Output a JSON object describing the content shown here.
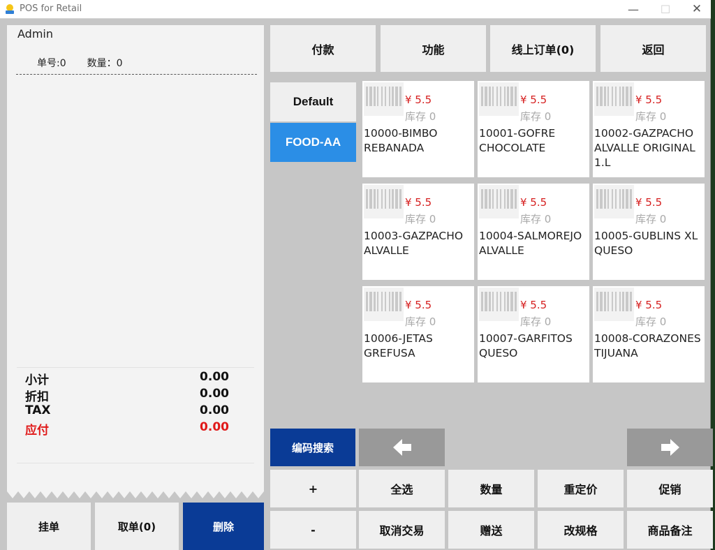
{
  "window": {
    "title": "POS for Retail",
    "minimize": "—",
    "maximize": "☐",
    "close": "✕"
  },
  "receipt": {
    "user": "Admin",
    "order_no": "单号:0",
    "quantity": "数量：0",
    "summary": [
      {
        "label": "小计",
        "value": "0.00"
      },
      {
        "label": "折扣",
        "value": "0.00"
      },
      {
        "label": "TAX",
        "value": "0.00"
      },
      {
        "label": "应付",
        "value": "0.00"
      }
    ]
  },
  "bottom_actions": {
    "hold": "挂单",
    "retrieve": "取单(0)",
    "delete": "删除"
  },
  "top_actions": {
    "pay": "付款",
    "functions": "功能",
    "online_orders": "线上订单(0)",
    "back": "返回"
  },
  "categories": [
    {
      "label": "Default",
      "active": false
    },
    {
      "label": "FOOD-AA",
      "active": true
    }
  ],
  "products": [
    {
      "name": "10000-BIMBO REBANADA",
      "price": "¥ 5.5",
      "stock": "库存 0"
    },
    {
      "name": "10001-GOFRE CHOCOLATE",
      "price": "¥ 5.5",
      "stock": "库存 0"
    },
    {
      "name": "10002-GAZPACHO ALVALLE ORIGINAL 1.L",
      "price": "¥ 5.5",
      "stock": "库存 0"
    },
    {
      "name": "10003-GAZPACHO ALVALLE",
      "price": "¥ 5.5",
      "stock": "库存 0"
    },
    {
      "name": "10004-SALMOREJO ALVALLE",
      "price": "¥ 5.5",
      "stock": "库存 0"
    },
    {
      "name": "10005-GUBLINS XL QUESO",
      "price": "¥ 5.5",
      "stock": "库存 0"
    },
    {
      "name": "10006-JETAS GREFUSA",
      "price": "¥ 5.5",
      "stock": "库存 0"
    },
    {
      "name": "10007-GARFITOS QUESO",
      "price": "¥ 5.5",
      "stock": "库存 0"
    },
    {
      "name": "10008-CORAZONES TIJUANA",
      "price": "¥ 5.5",
      "stock": "库存 0"
    }
  ],
  "search": {
    "label": "编码搜索"
  },
  "functions": {
    "plus": "+",
    "select_all": "全选",
    "quantity": "数量",
    "reprice": "重定价",
    "promotion": "促销",
    "minus": "-",
    "cancel_trade": "取消交易",
    "gift": "赠送",
    "change_spec": "改规格",
    "item_note": "商品备注"
  },
  "colors": {
    "accent_blue": "#0a3b96",
    "category_active": "#2b8ee6",
    "price_red": "#d62020",
    "due_red": "#e01919"
  }
}
